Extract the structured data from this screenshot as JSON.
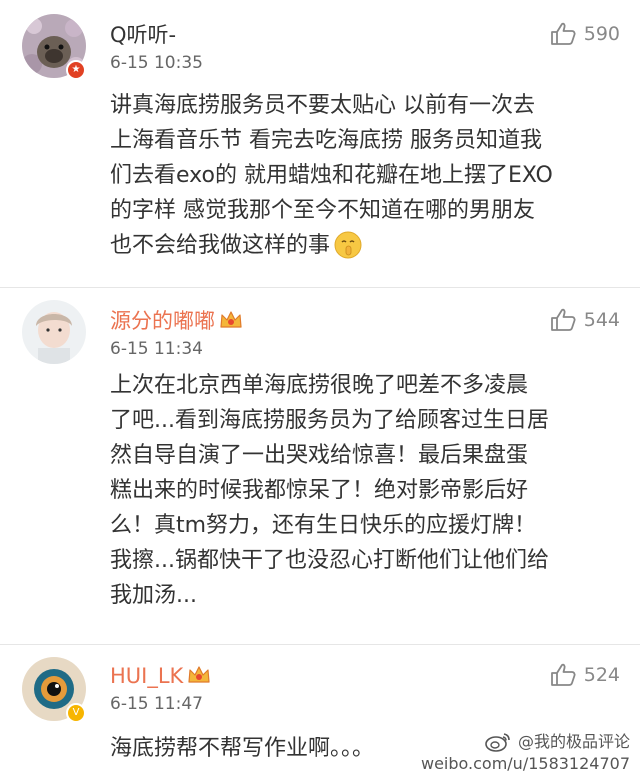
{
  "comments": [
    {
      "username": "Q听听-",
      "time": "6-15 10:35",
      "likes": "590",
      "text": "讲真海底捞服务员不要太贴心 以前有一次去\n上海看音乐节 看完去吃海底捞 服务员知道我\n们去看exo的 就用蜡烛和花瓣在地上摆了EXO\n的字样 感觉我那个至今不知道在哪的男朋友\n也不会给我做这样的事"
    },
    {
      "username": "源分的嘟嘟",
      "time": "6-15 11:34",
      "likes": "544",
      "text": "上次在北京西单海底捞很晚了吧差不多凌晨\n了吧...看到海底捞服务员为了给顾客过生日居\n然自导自演了一出哭戏给惊喜！最后果盘蛋\n糕出来的时候我都惊呆了！绝对影帝影后好\n么！真tm努力，还有生日快乐的应援灯牌！\n我擦...锅都快干了也没忍心打断他们让他们给\n我加汤..."
    },
    {
      "username": "HUI_LK",
      "time": "6-15 11:47",
      "likes": "524",
      "text": "海底捞帮不帮写作业啊。。。"
    }
  ],
  "watermark": {
    "handle": "@我的极品评论",
    "url": "weibo.com/u/1583124707"
  },
  "colors": {
    "vip_name": "#eb7350",
    "text": "#333333",
    "meta": "#666666",
    "divider": "#e6e6e6"
  },
  "icons": {
    "like": "thumbs-up-icon",
    "vip": "crown-icon",
    "emoji": "shh-emoji-icon",
    "watermark": "weibo-logo-icon"
  }
}
